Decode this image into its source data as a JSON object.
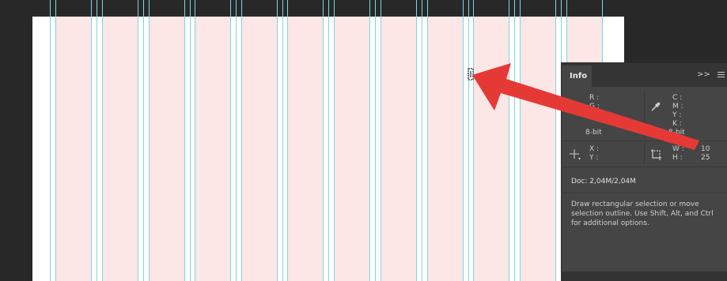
{
  "info_panel": {
    "tab_label": "Info",
    "expand_label": ">>",
    "rgb": {
      "r_label": "R :",
      "g_label": "G :",
      "bitdepth": "8-bit"
    },
    "cmyk": {
      "c_label": "C :",
      "m_label": "M :",
      "y_label": "Y :",
      "k_label": "K :",
      "bitdepth": "8-bit"
    },
    "position": {
      "x_label": "X :",
      "y_label": "Y :"
    },
    "size": {
      "w_label": "W :",
      "h_label": "H :",
      "w_value": "10",
      "h_value": "25"
    },
    "doc": "Doc: 2,04M/2,04M",
    "help_text": "Draw rectangular selection or move selection outline.  Use Shift, Alt, and Ctrl for additional options."
  },
  "colors": {
    "workspace": "#282828",
    "canvas": "#ffffff",
    "column_fill": "#fde6e6",
    "guide": "#7fd6e0",
    "arrow": "#e53935",
    "panel": "#454545"
  },
  "icons": [
    "eyedropper-icon",
    "crosshair-icon",
    "selection-size-icon",
    "panel-menu-icon",
    "move-cursor-icon"
  ]
}
